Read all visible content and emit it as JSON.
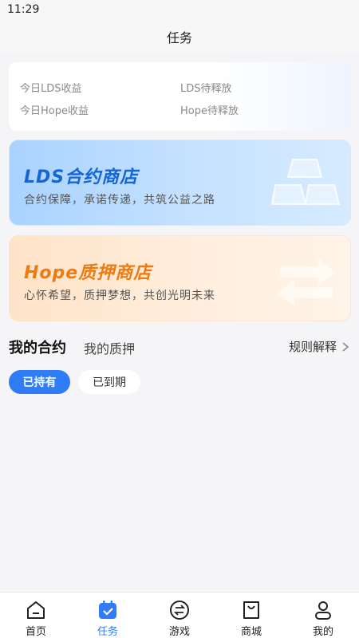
{
  "status_bar": {
    "time": "11:29"
  },
  "header": {
    "title": "任务"
  },
  "summary": {
    "today_lds_income": "今日LDS收益",
    "lds_pending_release": "LDS待释放",
    "today_hope_income": "今日Hope收益",
    "hope_pending_release": "Hope待释放"
  },
  "stores": [
    {
      "title": "LDS合约商店",
      "subtitle": "合约保障，承诺传递，共筑公益之路",
      "icon": "gold-bars-icon",
      "accent": "#1564d8"
    },
    {
      "title": "Hope质押商店",
      "subtitle": "心怀希望，质押梦想，共创光明未来",
      "icon": "exchange-arrows-icon",
      "accent": "#f07a12"
    }
  ],
  "section_tabs": {
    "active": "我的合约",
    "inactive": "我的质押"
  },
  "rules_link": {
    "label": "规则解释"
  },
  "filter_chips": {
    "held": "已持有",
    "expired": "已到期"
  },
  "bottom_nav": {
    "active_color": "#2f7cf6",
    "items": [
      {
        "label": "首页",
        "icon": "home-icon"
      },
      {
        "label": "任务",
        "icon": "calendar-check-icon"
      },
      {
        "label": "游戏",
        "icon": "swap-circle-icon"
      },
      {
        "label": "商城",
        "icon": "shopping-bag-icon"
      },
      {
        "label": "我的",
        "icon": "user-icon"
      }
    ]
  }
}
